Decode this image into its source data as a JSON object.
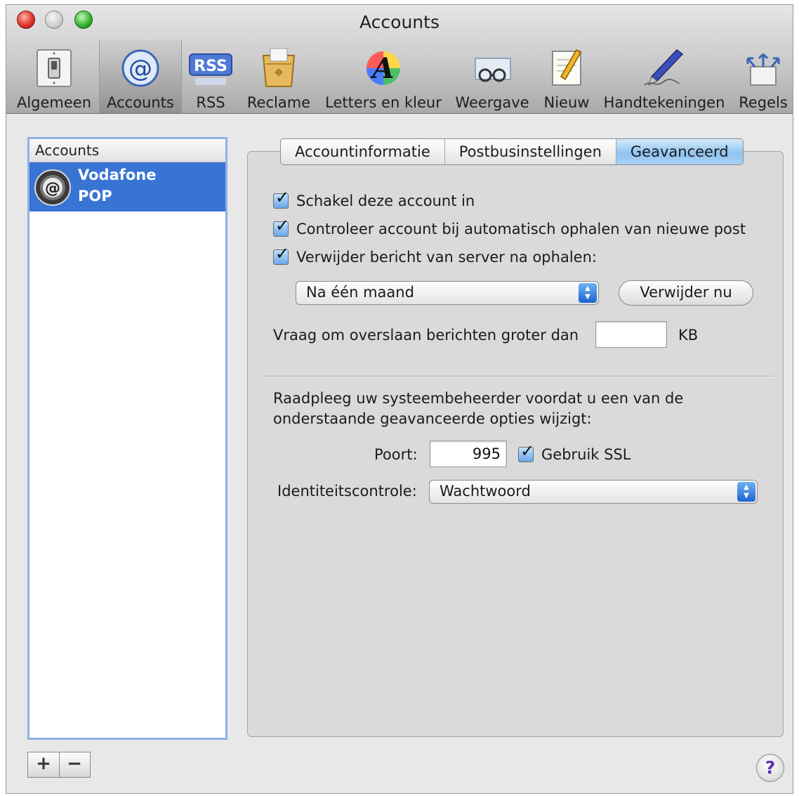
{
  "window": {
    "title": "Accounts"
  },
  "toolbar": {
    "items": [
      {
        "label": "Algemeen",
        "icon": "light-switch-icon"
      },
      {
        "label": "Accounts",
        "icon": "at-sign-icon",
        "selected": true
      },
      {
        "label": "RSS",
        "icon": "rss-icon",
        "icon_text": "RSS"
      },
      {
        "label": "Reclame",
        "icon": "junk-mail-icon"
      },
      {
        "label": "Letters en kleur",
        "icon": "fonts-colors-icon",
        "icon_text": "A"
      },
      {
        "label": "Weergave",
        "icon": "viewing-glasses-icon"
      },
      {
        "label": "Nieuw",
        "icon": "composing-icon"
      },
      {
        "label": "Handtekeningen",
        "icon": "signature-pen-icon"
      },
      {
        "label": "Regels",
        "icon": "rules-icon"
      }
    ]
  },
  "sidebar": {
    "header": "Accounts",
    "accounts": [
      {
        "name": "Vodafone",
        "type": "POP",
        "icon": "at-globe-icon",
        "icon_text": "@"
      }
    ],
    "add_label": "+",
    "remove_label": "−"
  },
  "tabs": [
    {
      "label": "Accountinformatie"
    },
    {
      "label": "Postbusinstellingen"
    },
    {
      "label": "Geavanceerd",
      "selected": true
    }
  ],
  "advanced": {
    "enable_account": {
      "label": "Schakel deze account in",
      "checked": true
    },
    "auto_check": {
      "label": "Controleer account bij automatisch ophalen van nieuwe post",
      "checked": true
    },
    "delete_from_server": {
      "label": "Verwijder bericht van server na ophalen:",
      "checked": true
    },
    "delete_after": {
      "value": "Na één maand"
    },
    "delete_now_label": "Verwijder nu",
    "skip_large": {
      "label": "Vraag om overslaan berichten groter dan",
      "value": "",
      "unit": "KB"
    },
    "admin_note_line1": "Raadpleeg uw systeembeheerder voordat u een van de",
    "admin_note_line2": "onderstaande geavanceerde opties wijzigt:",
    "port": {
      "label": "Poort:",
      "value": "995"
    },
    "use_ssl": {
      "label": "Gebruik SSL",
      "checked": true
    },
    "authentication": {
      "label": "Identiteitscontrole:",
      "value": "Wachtwoord"
    }
  },
  "help_label": "?",
  "colors": {
    "selection": "#3874d3",
    "tab_selected": "#8fc3ef",
    "checkbox": "#6aa6ea"
  }
}
